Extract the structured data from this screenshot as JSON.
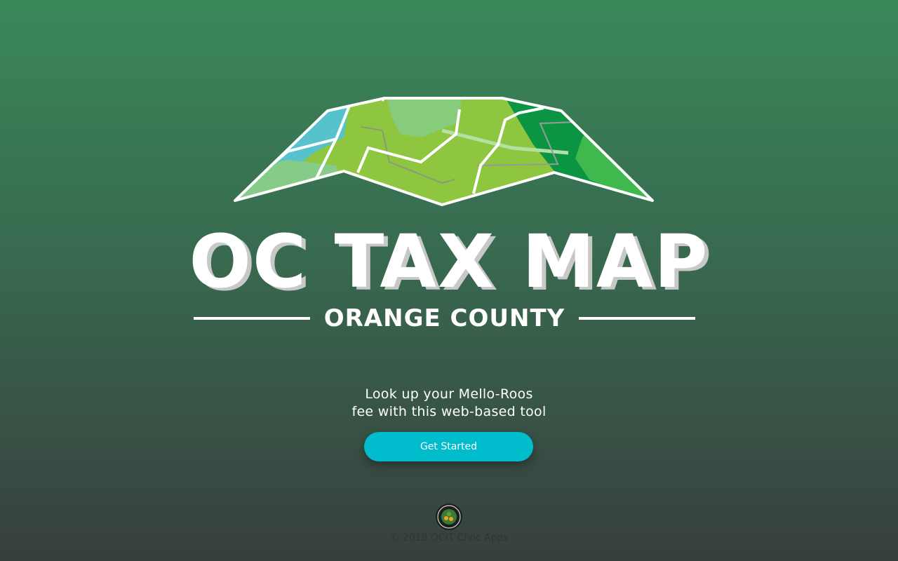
{
  "logo": {
    "icon": "folded-map-icon",
    "title": "OC TAX MAP",
    "subtitle": "ORANGE COUNTY"
  },
  "hero": {
    "tagline_line1": "Look up your Mello-Roos",
    "tagline_line2": "fee with this web-based tool",
    "cta_label": "Get Started"
  },
  "footer": {
    "seal_icon": "county-seal-icon",
    "copyright": "© 2018 OCIT Civic Apps"
  },
  "colors": {
    "accent": "#00bccc",
    "bg_top": "#3a8859",
    "bg_bottom": "#383f3e",
    "footer_text": "#2d3535"
  }
}
